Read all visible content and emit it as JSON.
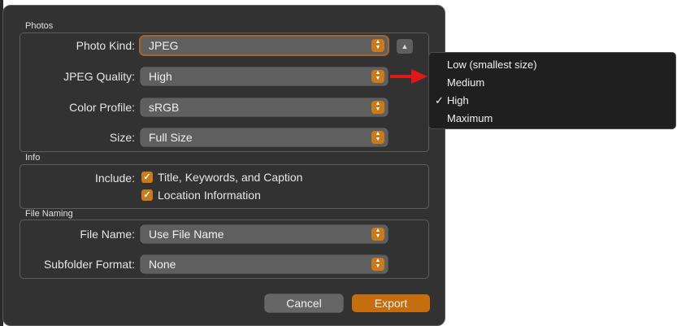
{
  "sections": {
    "photos": "Photos",
    "info": "Info",
    "file_naming": "File Naming"
  },
  "photos": {
    "kind_label": "Photo Kind:",
    "kind_value": "JPEG",
    "quality_label": "JPEG Quality:",
    "quality_value": "High",
    "profile_label": "Color Profile:",
    "profile_value": "sRGB",
    "size_label": "Size:",
    "size_value": "Full Size"
  },
  "info": {
    "include_label": "Include:",
    "checkboxes": [
      {
        "label": "Title, Keywords, and Caption",
        "checked": true
      },
      {
        "label": "Location Information",
        "checked": true
      }
    ]
  },
  "file_naming": {
    "name_label": "File Name:",
    "name_value": "Use File Name",
    "subfolder_label": "Subfolder Format:",
    "subfolder_value": "None"
  },
  "buttons": {
    "cancel": "Cancel",
    "export": "Export"
  },
  "quality_menu": {
    "items": [
      "Low (smallest size)",
      "Medium",
      "High",
      "Maximum"
    ],
    "selected": "High",
    "check_glyph": "✓"
  },
  "colors": {
    "accent": "#c97b1c",
    "annotation_arrow": "#e01818"
  }
}
